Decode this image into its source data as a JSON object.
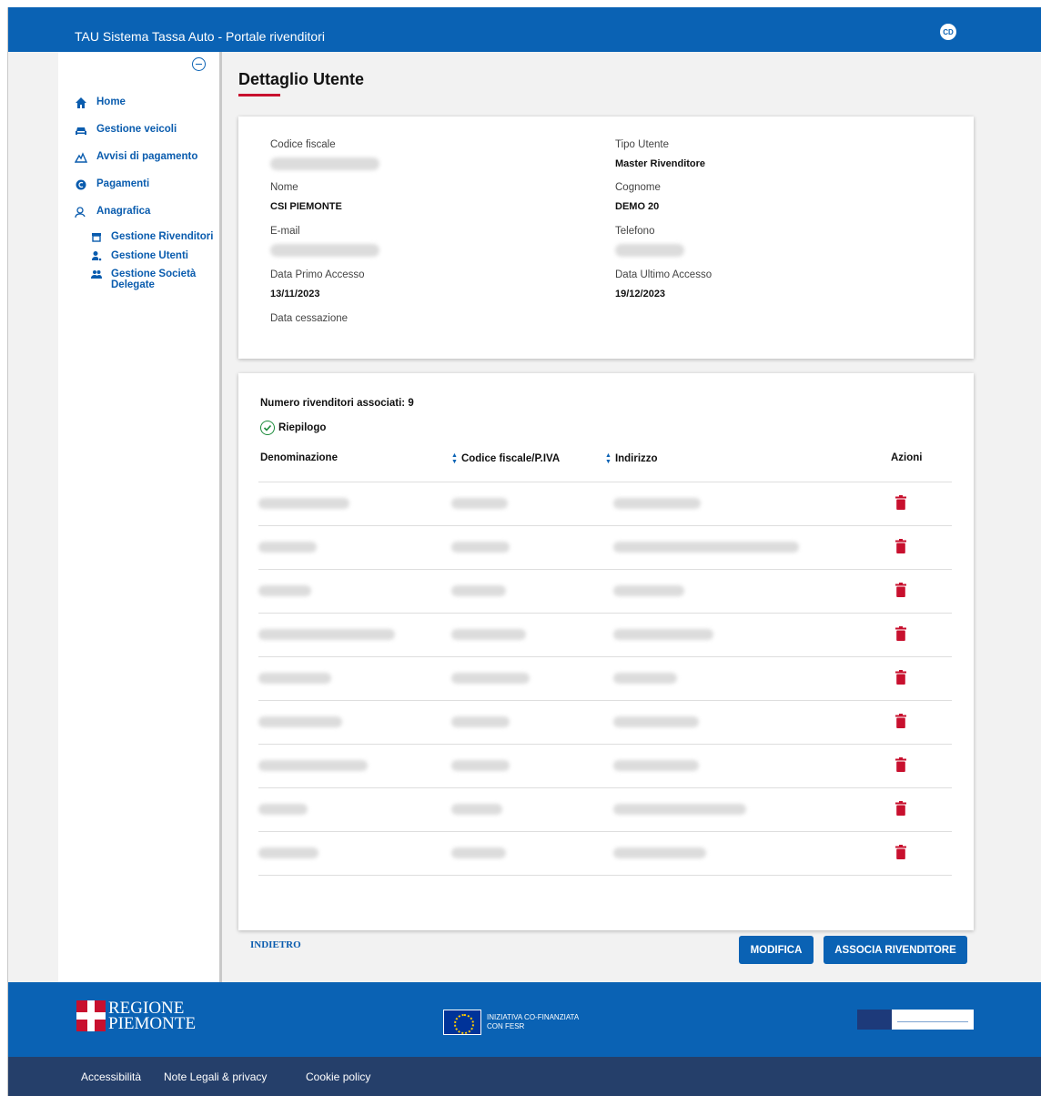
{
  "header": {
    "app_title": "TAU Sistema Tassa Auto - Portale rivenditori",
    "user_initials": "CD"
  },
  "sidebar": {
    "items": [
      {
        "label": "Home",
        "icon": "home-icon"
      },
      {
        "label": "Gestione veicoli",
        "icon": "car-icon"
      },
      {
        "label": "Avvisi di pagamento",
        "icon": "warning-icon"
      },
      {
        "label": "Pagamenti",
        "icon": "euro-icon"
      },
      {
        "label": "Anagrafica",
        "icon": "user-icon"
      }
    ],
    "subitems": [
      {
        "label": "Gestione Rivenditori",
        "icon": "store-icon"
      },
      {
        "label": "Gestione Utenti",
        "icon": "user-gear-icon"
      },
      {
        "label": "Gestione Società Delegate",
        "icon": "people-icon"
      }
    ]
  },
  "page": {
    "title": "Dettaglio Utente"
  },
  "user": {
    "codice_fiscale_label": "Codice fiscale",
    "tipo_utente_label": "Tipo Utente",
    "tipo_utente_value": "Master Rivenditore",
    "nome_label": "Nome",
    "nome_value": "CSI PIEMONTE",
    "cognome_label": "Cognome",
    "cognome_value": "DEMO 20",
    "email_label": "E-mail",
    "telefono_label": "Telefono",
    "primo_accesso_label": "Data Primo Accesso",
    "primo_accesso_value": "13/11/2023",
    "ultimo_accesso_label": "Data Ultimo Accesso",
    "ultimo_accesso_value": "19/12/2023",
    "cessazione_label": "Data cessazione"
  },
  "dealers": {
    "count_text": "Numero rivenditori associati: 9",
    "summary_label": "Riepilogo",
    "columns": [
      "Denominazione",
      "Codice fiscale/P.IVA",
      "Indirizzo",
      "Azioni"
    ],
    "rows": 9
  },
  "actions": {
    "back_label": "INDIETRO",
    "edit_label": "MODIFICA",
    "associate_label": "ASSOCIA RIVENDITORE"
  },
  "footer": {
    "regione_line1": "REGIONE",
    "regione_line2": "PIEMONTE",
    "eu_line1": "INIZIATIVA CO-FINANZIATA",
    "eu_line2": "CON FESR",
    "links": [
      "Accessibilità",
      "Note Legali & privacy",
      "Cookie policy"
    ]
  },
  "colors": {
    "primary": "#0a62b4",
    "footer_dark": "#253f6a",
    "accent_red": "#c8102e",
    "success": "#1b8a3a"
  }
}
